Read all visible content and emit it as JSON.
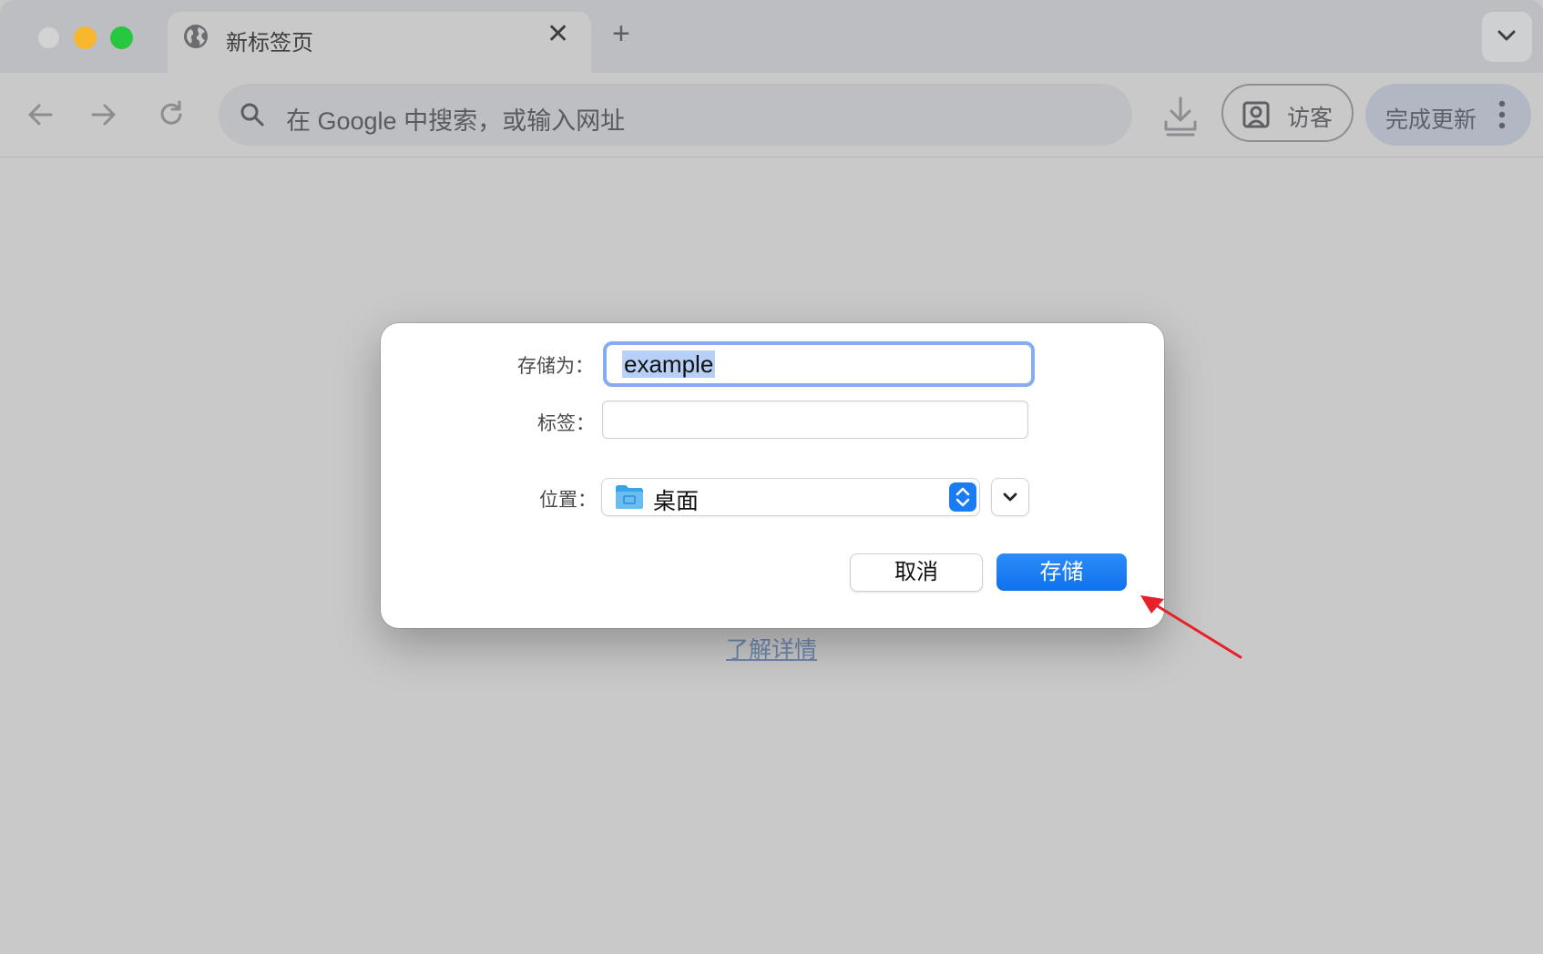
{
  "tab": {
    "title": "新标签页"
  },
  "omnibox": {
    "placeholder": "在 Google 中搜索，或输入网址"
  },
  "toolbar": {
    "guest_label": "访客",
    "update_label": "完成更新"
  },
  "page": {
    "learn_more": "了解详情"
  },
  "dialog": {
    "save_as_label": "存储为：",
    "save_as_value": "example",
    "tags_label": "标签：",
    "tags_value": "",
    "location_label": "位置：",
    "location_value": "桌面",
    "cancel_label": "取消",
    "save_label": "存储"
  },
  "colors": {
    "accent": "#1a7cf5",
    "annotation_arrow": "#e8202a"
  }
}
